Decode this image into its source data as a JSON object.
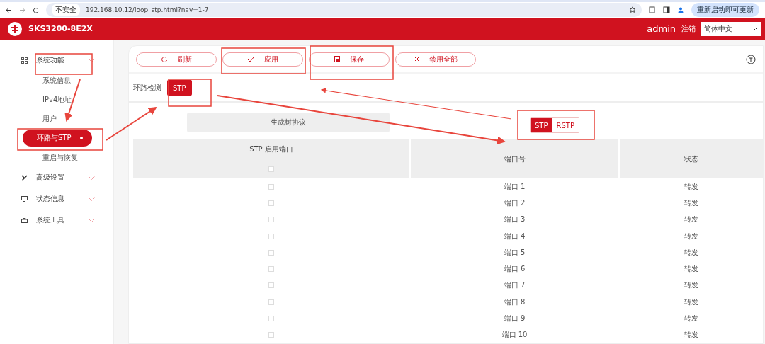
{
  "browser": {
    "security": "不安全",
    "url": "192.168.10.12/loop_stp.html?nav=1-7",
    "update_button": "重新启动即可更新"
  },
  "header": {
    "model": "SKS3200-8E2X",
    "user": "admin",
    "logout": "注销",
    "language": "简体中文"
  },
  "sidebar": {
    "items": [
      {
        "label": "系统功能",
        "expanded": true,
        "children": [
          {
            "label": "系统信息",
            "selected": false
          },
          {
            "label": "IPv4地址",
            "selected": false
          },
          {
            "label": "用户",
            "selected": false
          },
          {
            "label": "环路与STP",
            "selected": true
          },
          {
            "label": "重启与恢复",
            "selected": false
          }
        ]
      },
      {
        "label": "高级设置",
        "expanded": false
      },
      {
        "label": "状态信息",
        "expanded": false
      },
      {
        "label": "系统工具",
        "expanded": false
      }
    ]
  },
  "toolbar": {
    "buttons": [
      {
        "kind": "refresh",
        "label": "刷新"
      },
      {
        "kind": "apply",
        "label": "应用"
      },
      {
        "kind": "save",
        "label": "保存"
      },
      {
        "kind": "disable",
        "label": "禁用全部"
      }
    ]
  },
  "tab_bar": {
    "label": "环路检测",
    "tabs": [
      {
        "label": "STP",
        "selected": true
      }
    ]
  },
  "section_title": "生成树协议",
  "table": {
    "columns": [
      "STP 启用端口",
      "端口号",
      "状态"
    ],
    "select_all_checked": false,
    "rows": [
      {
        "checked": false,
        "port": "端口 1",
        "status": "转发"
      },
      {
        "checked": false,
        "port": "端口 2",
        "status": "转发"
      },
      {
        "checked": false,
        "port": "端口 3",
        "status": "转发"
      },
      {
        "checked": false,
        "port": "端口 4",
        "status": "转发"
      },
      {
        "checked": false,
        "port": "端口 5",
        "status": "转发"
      },
      {
        "checked": false,
        "port": "端口 6",
        "status": "转发"
      },
      {
        "checked": false,
        "port": "端口 7",
        "status": "转发"
      },
      {
        "checked": false,
        "port": "端口 8",
        "status": "转发"
      },
      {
        "checked": false,
        "port": "端口 9",
        "status": "转发"
      },
      {
        "checked": false,
        "port": "端口 10",
        "status": "转发"
      }
    ]
  },
  "callout": {
    "options": [
      {
        "label": "STP",
        "selected": true
      },
      {
        "label": "RSTP",
        "selected": false
      }
    ]
  }
}
